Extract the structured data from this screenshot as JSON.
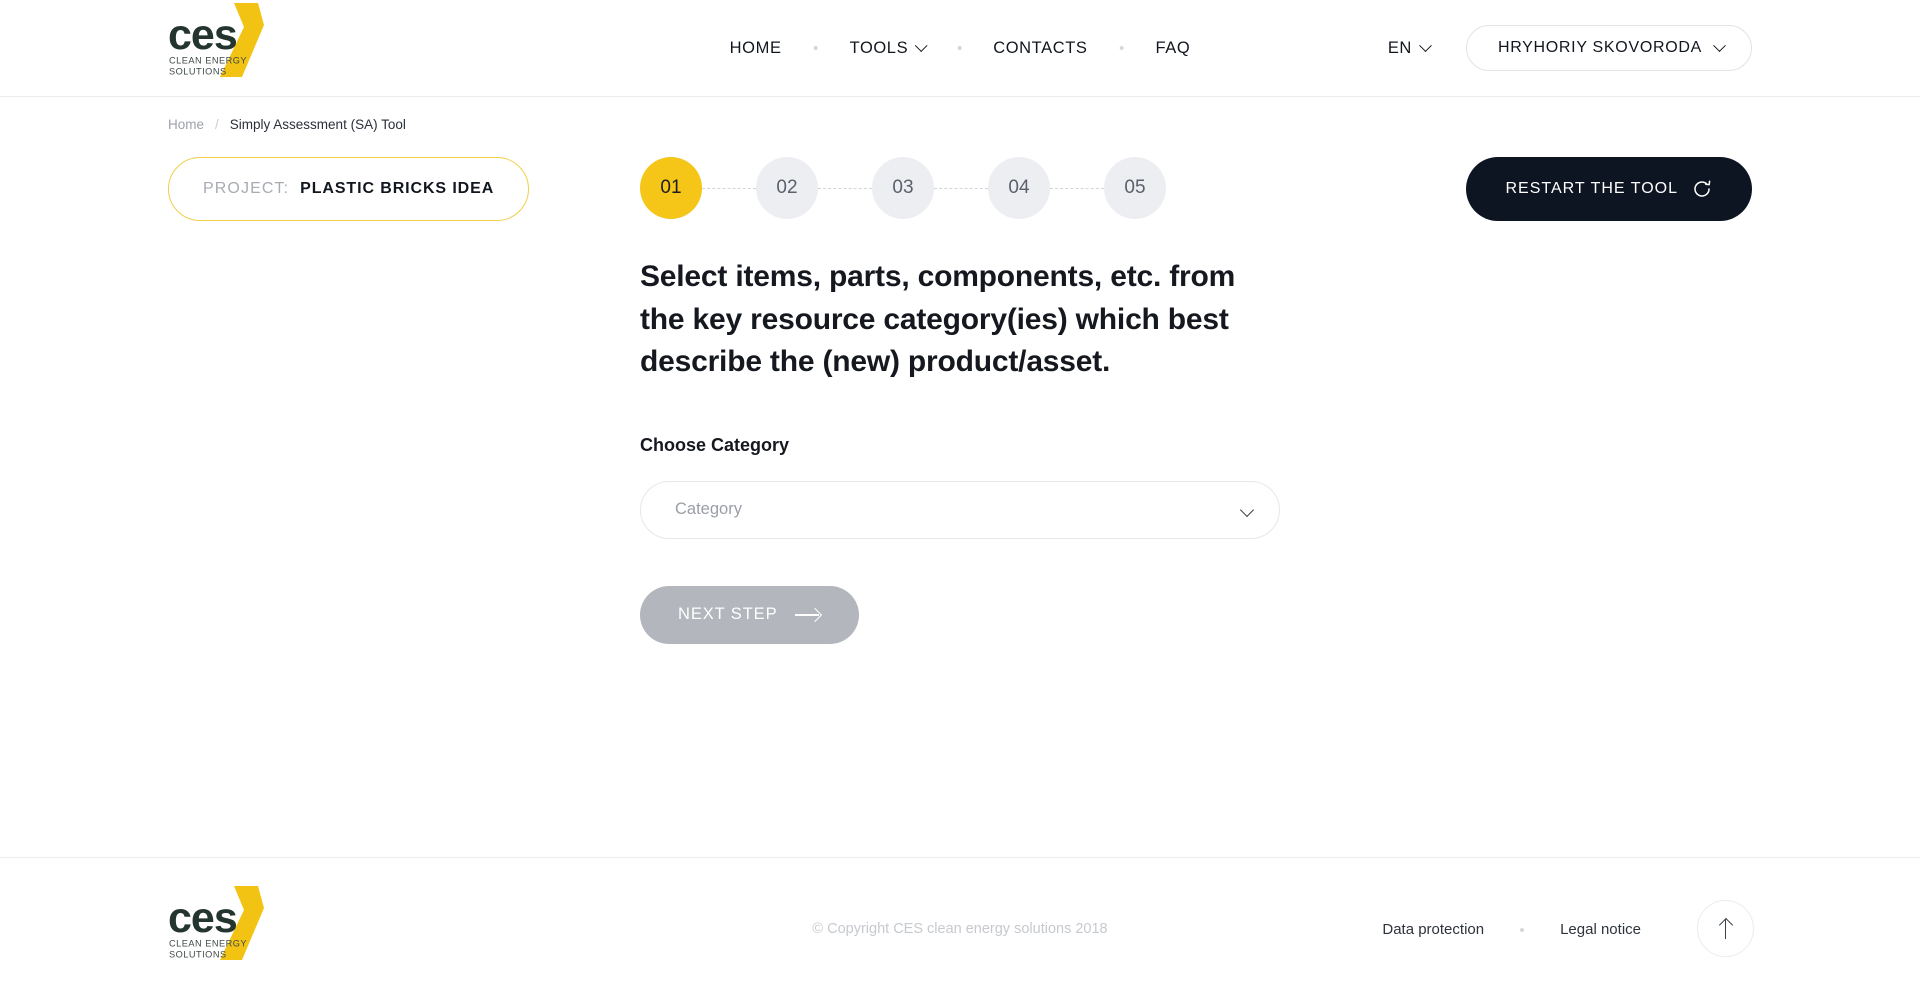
{
  "header": {
    "logo": {
      "wordmark": "ces",
      "tagline_line1": "CLEAN ENERGY",
      "tagline_line2": "SOLUTIONS",
      "wordmark_color": "#23352e",
      "accent_color": "#f2c313"
    },
    "nav": [
      {
        "label": "HOME",
        "has_dropdown": false
      },
      {
        "label": "TOOLS",
        "has_dropdown": true
      },
      {
        "label": "CONTACTS",
        "has_dropdown": false
      },
      {
        "label": "FAQ",
        "has_dropdown": false
      }
    ],
    "language": {
      "label": "EN",
      "has_dropdown": true
    },
    "user": {
      "name": "HRYHORIY SKOVORODA",
      "has_dropdown": true
    }
  },
  "breadcrumb": {
    "home": "Home",
    "separator": "/",
    "current": "Simply Assessment (SA) Tool"
  },
  "toolbar": {
    "project_label": "PROJECT:",
    "project_value": "PLASTIC BRICKS IDEA",
    "restart_label": "RESTART THE TOOL",
    "restart_icon": "refresh-icon",
    "steps": [
      {
        "number": "01",
        "active": true
      },
      {
        "number": "02",
        "active": false
      },
      {
        "number": "03",
        "active": false
      },
      {
        "number": "04",
        "active": false
      },
      {
        "number": "05",
        "active": false
      }
    ]
  },
  "main": {
    "headline": "Select items, parts, components, etc. from the key resource category(ies) which best describe the (new) product/asset.",
    "field_label": "Choose Category",
    "select": {
      "value": "",
      "placeholder": "Category",
      "icon": "chevron-down-icon"
    },
    "next_label": "NEXT STEP",
    "next_icon": "arrow-right-icon"
  },
  "footer": {
    "copyright": "© Copyright CES clean energy solutions 2018",
    "links": [
      {
        "label": "Data protection"
      },
      {
        "label": "Legal notice"
      }
    ],
    "to_top_icon": "arrow-up-icon"
  },
  "colors": {
    "accent_yellow": "#f5c518",
    "logo_yellow": "#f2c313",
    "dark": "#0d1522",
    "step_inactive_bg": "#eceef1",
    "disabled_button": "#b3b6bc"
  }
}
